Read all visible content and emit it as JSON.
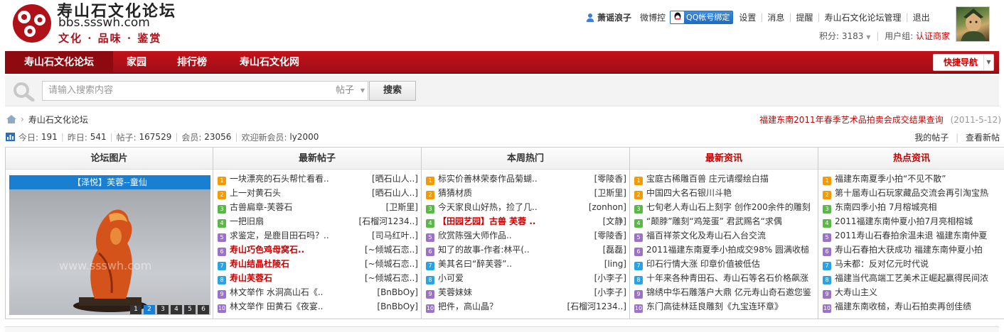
{
  "logo": {
    "title": "寿山石文化论坛",
    "domain": "bbs.ssswh.com",
    "slogan": "文化 · 品味 · 鉴赏"
  },
  "user": {
    "name": "萧谣浪子",
    "links": [
      "微博控"
    ],
    "qq_label": "QQ帐号绑定",
    "menu": [
      "设置",
      "消息",
      "提醒",
      "寿山石文化论坛管理",
      "退出"
    ],
    "credits_label": "积分:",
    "credits_value": "3183",
    "group_label": "用户组:",
    "group_value": "认证商家"
  },
  "nav": {
    "items": [
      "寿山石文化论坛",
      "家园",
      "排行榜",
      "寿山石文化网"
    ],
    "quick": "快捷导航"
  },
  "search": {
    "placeholder": "请输入搜索内容",
    "type": "帖子",
    "button": "搜索"
  },
  "breadcrumb": {
    "current": "寿山石文化论坛"
  },
  "notice": {
    "title": "福建东南2011年春季艺术品拍卖会成交结果查询",
    "date": "(2011-5-12)"
  },
  "stats": {
    "today_label": "今日:",
    "today": "191",
    "yday_label": "昨日:",
    "yday": "541",
    "posts_label": "帖子:",
    "posts": "167529",
    "members_label": "会员:",
    "members": "23056",
    "welcome": "欢迎新会员:",
    "newest": "ly2000"
  },
  "right_links": [
    "我的帖子",
    "查看新帖"
  ],
  "board": {
    "headers": [
      "论坛图片",
      "最新帖子",
      "本周热门",
      "最新资讯",
      "热点资讯"
    ],
    "slide_caption": "【泽悦】芙蓉--童仙",
    "slide_watermark": "www.ssswh.com",
    "pager": [
      "1",
      "2",
      "3",
      "4",
      "5",
      "6"
    ],
    "latest": [
      {
        "n": "1",
        "t": "一块漂亮的石头帮忙看看..",
        "a": "[晒石山人..]"
      },
      {
        "n": "2",
        "t": "上一对黄石头",
        "a": "[晒石山人..]"
      },
      {
        "n": "3",
        "t": "古兽扁章-芙蓉石",
        "a": "[卫斯里]"
      },
      {
        "n": "4",
        "t": "一把旧扇",
        "a": "[石榴河1234..]"
      },
      {
        "n": "5",
        "t": "求鉴定，是鹿目田石吗？..",
        "a": "[司马红叶..]"
      },
      {
        "n": "6",
        "t": "寿山巧色鸡母窝石..",
        "a": "[~倾城石恋..]"
      },
      {
        "n": "7",
        "t": "寿山结晶杜陵石",
        "a": "[~倾城石恋..]"
      },
      {
        "n": "8",
        "t": "寿山芙蓉石",
        "a": "[~倾城石恋..]"
      },
      {
        "n": "9",
        "t": "林文举作 水洞高山石《..",
        "a": "[BnBbOy]"
      },
      {
        "n": "10",
        "t": "林文举作 田黄石《夜宴..",
        "a": "[BnBbOy]"
      }
    ],
    "hot": [
      {
        "n": "1",
        "t": "标实价善林荣泰作品菊蝴..",
        "a": "[零陵香]"
      },
      {
        "n": "2",
        "t": "猜猜材质",
        "a": "[卫斯里]"
      },
      {
        "n": "3",
        "t": "今天家良山好热，捡了几..",
        "a": "[zonhon]"
      },
      {
        "n": "4",
        "t": "【田园艺园】古兽  芙蓉 ..",
        "a": "[文静]"
      },
      {
        "n": "5",
        "t": "欣赏陈强大师作品..",
        "a": "[零陵香]"
      },
      {
        "n": "6",
        "t": "知了的故事-作者:林平(..",
        "a": "[磊磊]"
      },
      {
        "n": "7",
        "t": "美其名曰“醉芙蓉”..",
        "a": "[ling]"
      },
      {
        "n": "8",
        "t": "小可爱",
        "a": "[小李子]"
      },
      {
        "n": "9",
        "t": "芙蓉妹妹",
        "a": "[小李子]"
      },
      {
        "n": "10",
        "t": "把件，高山晶？",
        "a": "[石榴河1234..]"
      }
    ],
    "news": [
      {
        "n": "1",
        "t": "宝庭古稀雕百兽  庄元请缨绘白描"
      },
      {
        "n": "2",
        "t": "中国四大名石银川斗艳"
      },
      {
        "n": "3",
        "t": "七旬老人寿山石上刻字 创作200余件的雕刻"
      },
      {
        "n": "4",
        "t": "“颠脖”雕刻“鸡笼蛋”  君武赐名“求偶"
      },
      {
        "n": "5",
        "t": "福百祥茶文化及寿山石入台交流"
      },
      {
        "n": "6",
        "t": "2011福建东南夏季小拍成交98% 圆满收槌"
      },
      {
        "n": "7",
        "t": "印石行情大涨 印章价值被低估"
      },
      {
        "n": "8",
        "t": "十年来各种青田石、寿山石等名石价格飙涨"
      },
      {
        "n": "9",
        "t": "锦绣中华石雕落户大鼎 亿元寿山奇石邀您鉴"
      },
      {
        "n": "10",
        "t": "东门高徒林廷良雕刻《九宝连环章》"
      }
    ],
    "hotnews": [
      {
        "n": "1",
        "t": "福建东南夏季小拍“不见不散”"
      },
      {
        "n": "2",
        "t": "第十届寿山石玩家藏品交流会再引淘宝热"
      },
      {
        "n": "3",
        "t": "东南四季小拍 7月榕城亮相"
      },
      {
        "n": "4",
        "t": "2011福建东南仲夏小拍7月亮相榕城"
      },
      {
        "n": "5",
        "t": "2011寿山石春拍余温未退 福建东南仲夏"
      },
      {
        "n": "6",
        "t": "寿山石春拍大获成功 福建东南仲夏小拍"
      },
      {
        "n": "7",
        "t": "马未都：反对亿元时代说"
      },
      {
        "n": "8",
        "t": "福建当代高端工艺美术正崛起赢得民间浓"
      },
      {
        "n": "9",
        "t": "大寿山主义"
      },
      {
        "n": "10",
        "t": "福建东南收槌，寿山石拍卖再创佳绩"
      }
    ]
  },
  "colors": {
    "brand_red": "#c4121b",
    "link_red": "#cc0000",
    "accent_blue": "#1a7fd0"
  }
}
